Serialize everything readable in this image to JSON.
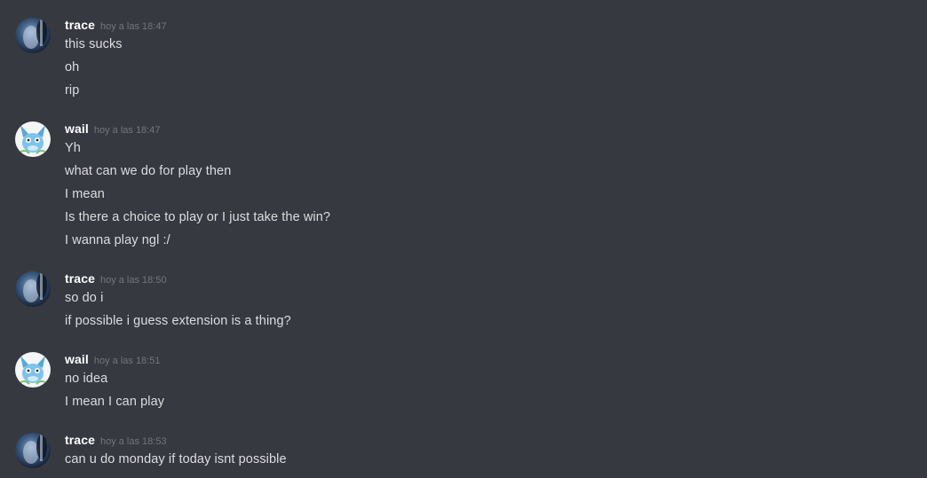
{
  "messages": [
    {
      "username": "trace",
      "timestamp": "hoy a las 18:47",
      "avatar_icon": "trace-avatar-icon",
      "lines": [
        "this sucks",
        "oh",
        "rip"
      ]
    },
    {
      "username": "wail",
      "timestamp": "hoy a las 18:47",
      "avatar_icon": "wail-avatar-icon",
      "lines": [
        "Yh",
        "what can we do for play then",
        "I mean",
        "Is there a choice to play or I just take the win?",
        "I wanna play ngl :/"
      ]
    },
    {
      "username": "trace",
      "timestamp": "hoy a las 18:50",
      "avatar_icon": "trace-avatar-icon",
      "lines": [
        "so do i",
        "if possible i guess extension is a thing?"
      ]
    },
    {
      "username": "wail",
      "timestamp": "hoy a las 18:51",
      "avatar_icon": "wail-avatar-icon",
      "lines": [
        "no idea",
        "I mean I can play"
      ]
    },
    {
      "username": "trace",
      "timestamp": "hoy a las 18:53",
      "avatar_icon": "trace-avatar-icon",
      "lines": [
        "can u do monday if today isnt possible"
      ]
    }
  ],
  "colors": {
    "background": "#36393f",
    "username": "#ffffff",
    "timestamp": "#72767d",
    "message_text": "#dcddde"
  }
}
